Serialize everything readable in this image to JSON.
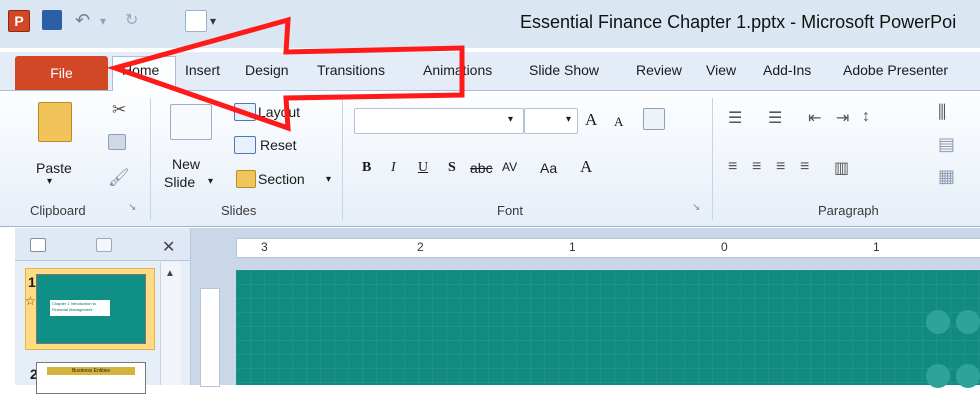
{
  "window": {
    "title": "Essential Finance Chapter 1.pptx - Microsoft PowerPoi",
    "app_icon": "P"
  },
  "tabs": {
    "file": "File",
    "items": [
      "Home",
      "Insert",
      "Design",
      "Transitions",
      "Animations",
      "Slide Show",
      "Review",
      "View",
      "Add-Ins",
      "Adobe Presenter"
    ]
  },
  "ribbon": {
    "clipboard": {
      "paste": "Paste",
      "group": "Clipboard"
    },
    "slides": {
      "new_slide_line1": "New",
      "new_slide_line2": "Slide",
      "layout": "Layout",
      "reset": "Reset",
      "section": "Section",
      "group": "Slides"
    },
    "font": {
      "bold": "B",
      "italic": "I",
      "underline": "U",
      "shadow": "S",
      "strike": "abc",
      "spacing": "AV",
      "case": "Aa",
      "color": "A",
      "grow": "A",
      "shrink": "A",
      "group": "Font"
    },
    "paragraph": {
      "group": "Paragraph"
    }
  },
  "pane": {
    "slide1_num": "1",
    "slide2_num": "2",
    "slide1_line1": "Chapter 1 Introduction to",
    "slide1_line2": "Financial Management",
    "slide2_title": "Business Entities"
  },
  "ruler": {
    "labels": [
      "3",
      "2",
      "1",
      "0",
      "1"
    ]
  },
  "colors": {
    "file_tab": "#d24726",
    "slide_bg": "#118a82",
    "arrow": "#ff1a1a"
  }
}
